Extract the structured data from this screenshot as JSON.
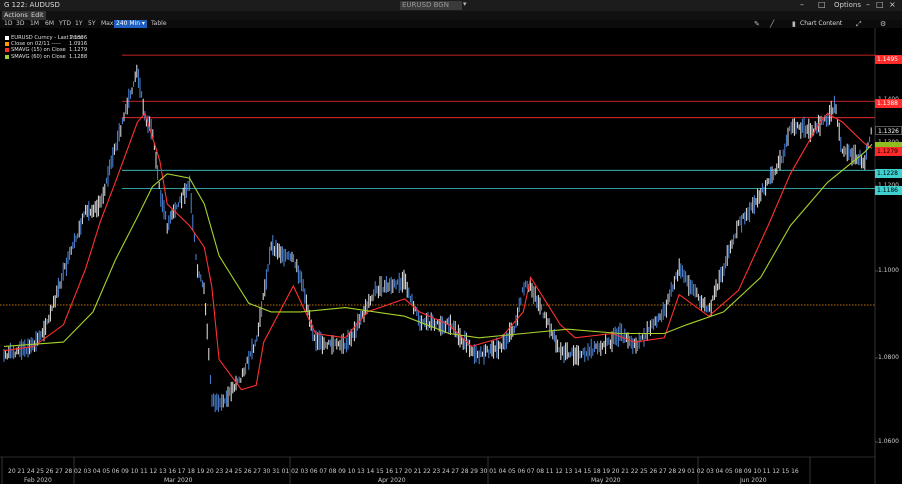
{
  "window": {
    "title": "G 122: AUDUSD",
    "security_field": "EURUSD BGN Curncy",
    "options_label": "Options",
    "controls": [
      "–",
      "□",
      "×"
    ]
  },
  "menu": {
    "actions": "Actions",
    "edit": "Edit"
  },
  "toolbar": {
    "periods": [
      "1D",
      "3D",
      "1M",
      "6M",
      "YTD",
      "1Y",
      "5Y",
      "Max"
    ],
    "interval": "240 Min",
    "table_label": "Table",
    "chart_content_label": "Chart Content"
  },
  "legend": [
    {
      "name": "EURUSD Curncy - Last Price",
      "value": "1.1336",
      "color": "#ffffff"
    },
    {
      "name": "Close on 02/11 -----",
      "value": "1.0916",
      "color": "#ff9900"
    },
    {
      "name": "SMAVG (15) on Close",
      "value": "1.1279",
      "color": "#ff3030"
    },
    {
      "name": "SMAVG (60) on Close",
      "value": "1.1288",
      "color": "#a6d22c"
    }
  ],
  "y_axis": {
    "labels": [
      "1.1400",
      "1.1300",
      "1.1200",
      "1.1000",
      "1.0800",
      "1.0600"
    ]
  },
  "x_axis": {
    "day_labels": [
      "20",
      "21",
      "24",
      "25",
      "26",
      "27",
      "28",
      "02",
      "03",
      "04",
      "05",
      "06",
      "09",
      "10",
      "11",
      "12",
      "13",
      "16",
      "17",
      "18",
      "19",
      "20",
      "23",
      "24",
      "25",
      "26",
      "27",
      "30",
      "31",
      "01",
      "02",
      "03",
      "06",
      "07",
      "08",
      "09",
      "10",
      "13",
      "14",
      "15",
      "16",
      "17",
      "20",
      "21",
      "22",
      "23",
      "24",
      "27",
      "28",
      "29",
      "30",
      "01",
      "04",
      "05",
      "06",
      "07",
      "08",
      "11",
      "12",
      "13",
      "14",
      "15",
      "18",
      "19",
      "20",
      "21",
      "22",
      "25",
      "26",
      "27",
      "28",
      "29",
      "01",
      "02",
      "03",
      "04",
      "05",
      "08",
      "09",
      "10",
      "11",
      "12",
      "15",
      "16"
    ],
    "month_labels": [
      "Feb 2020",
      "Mar 2020",
      "Apr 2020",
      "May 2020",
      "Jun 2020"
    ]
  },
  "chart_data": {
    "type": "line",
    "title": "",
    "xlabel": "",
    "ylabel": "",
    "ylim": [
      1.058,
      1.153
    ],
    "x_range": [
      "2020-02-20",
      "2020-06-16"
    ],
    "grid": false,
    "series": [
      {
        "name": "EURUSD Curncy - Last Price",
        "style": "ohlc-bars",
        "color": "#ffffff",
        "x": [
          "2020-02-20",
          "2020-02-24",
          "2020-02-26",
          "2020-02-28",
          "2020-03-02",
          "2020-03-04",
          "2020-03-06",
          "2020-03-09",
          "2020-03-10",
          "2020-03-11",
          "2020-03-12",
          "2020-03-13",
          "2020-03-16",
          "2020-03-17",
          "2020-03-18",
          "2020-03-19",
          "2020-03-20",
          "2020-03-23",
          "2020-03-25",
          "2020-03-27",
          "2020-03-30",
          "2020-03-31",
          "2020-04-02",
          "2020-04-06",
          "2020-04-08",
          "2020-04-10",
          "2020-04-14",
          "2020-04-16",
          "2020-04-20",
          "2020-04-22",
          "2020-04-24",
          "2020-04-27",
          "2020-04-29",
          "2020-04-30",
          "2020-05-01",
          "2020-05-05",
          "2020-05-07",
          "2020-05-11",
          "2020-05-13",
          "2020-05-15",
          "2020-05-19",
          "2020-05-21",
          "2020-05-25",
          "2020-05-27",
          "2020-05-29",
          "2020-06-02",
          "2020-06-04",
          "2020-06-05",
          "2020-06-08",
          "2020-06-10",
          "2020-06-11",
          "2020-06-12",
          "2020-06-15",
          "2020-06-16"
        ],
        "y": [
          1.08,
          1.082,
          1.088,
          1.099,
          1.113,
          1.115,
          1.128,
          1.146,
          1.135,
          1.132,
          1.118,
          1.11,
          1.12,
          1.1,
          1.095,
          1.07,
          1.068,
          1.075,
          1.083,
          1.105,
          1.102,
          1.098,
          1.083,
          1.082,
          1.088,
          1.095,
          1.097,
          1.088,
          1.087,
          1.083,
          1.08,
          1.082,
          1.087,
          1.096,
          1.096,
          1.081,
          1.08,
          1.082,
          1.085,
          1.082,
          1.09,
          1.1,
          1.09,
          1.1,
          1.11,
          1.12,
          1.126,
          1.133,
          1.132,
          1.135,
          1.138,
          1.127,
          1.125,
          1.132
        ]
      },
      {
        "name": "SMAVG (15) on Close",
        "value": 1.1279,
        "color": "#ff3030",
        "x": [
          "2020-02-20",
          "2020-02-24",
          "2020-02-28",
          "2020-03-02",
          "2020-03-04",
          "2020-03-06",
          "2020-03-09",
          "2020-03-10",
          "2020-03-12",
          "2020-03-13",
          "2020-03-16",
          "2020-03-18",
          "2020-03-19",
          "2020-03-20",
          "2020-03-23",
          "2020-03-25",
          "2020-03-26",
          "2020-03-30",
          "2020-04-02",
          "2020-04-06",
          "2020-04-09",
          "2020-04-14",
          "2020-04-16",
          "2020-04-20",
          "2020-04-23",
          "2020-04-27",
          "2020-04-30",
          "2020-05-01",
          "2020-05-05",
          "2020-05-07",
          "2020-05-12",
          "2020-05-15",
          "2020-05-19",
          "2020-05-21",
          "2020-05-25",
          "2020-05-29",
          "2020-06-02",
          "2020-06-05",
          "2020-06-09",
          "2020-06-10",
          "2020-06-12",
          "2020-06-15",
          "2020-06-16"
        ],
        "y": [
          1.081,
          1.082,
          1.087,
          1.1,
          1.111,
          1.12,
          1.134,
          1.136,
          1.125,
          1.115,
          1.11,
          1.105,
          1.096,
          1.079,
          1.072,
          1.073,
          1.083,
          1.096,
          1.085,
          1.084,
          1.09,
          1.093,
          1.09,
          1.087,
          1.082,
          1.084,
          1.09,
          1.098,
          1.087,
          1.084,
          1.085,
          1.083,
          1.084,
          1.094,
          1.089,
          1.095,
          1.11,
          1.122,
          1.134,
          1.136,
          1.134,
          1.129,
          1.1279
        ]
      },
      {
        "name": "SMAVG (60) on Close",
        "value": 1.1288,
        "color": "#a6d22c",
        "x": [
          "2020-02-20",
          "2020-02-28",
          "2020-03-03",
          "2020-03-06",
          "2020-03-09",
          "2020-03-11",
          "2020-03-13",
          "2020-03-16",
          "2020-03-18",
          "2020-03-20",
          "2020-03-24",
          "2020-03-27",
          "2020-03-31",
          "2020-04-06",
          "2020-04-14",
          "2020-04-20",
          "2020-04-24",
          "2020-04-30",
          "2020-05-06",
          "2020-05-13",
          "2020-05-19",
          "2020-05-22",
          "2020-05-27",
          "2020-06-01",
          "2020-06-05",
          "2020-06-10",
          "2020-06-15",
          "2020-06-16"
        ],
        "y": [
          1.082,
          1.083,
          1.09,
          1.102,
          1.112,
          1.119,
          1.122,
          1.121,
          1.115,
          1.103,
          1.092,
          1.09,
          1.09,
          1.091,
          1.089,
          1.085,
          1.084,
          1.085,
          1.086,
          1.085,
          1.085,
          1.087,
          1.09,
          1.098,
          1.11,
          1.12,
          1.127,
          1.1288
        ]
      },
      {
        "name": "Close on 02/11",
        "value": 1.0916,
        "color": "#ff9900",
        "style": "horizontal-dotted"
      }
    ],
    "horizontal_lines": [
      {
        "value": 1.1495,
        "label": "1.1495",
        "color": "#ff3030"
      },
      {
        "value": 1.1388,
        "label": "1.1388",
        "color": "#ff3030"
      },
      {
        "value": 1.135,
        "label": "",
        "color": "#ff3030"
      },
      {
        "value": 1.1228,
        "label": "1.1228",
        "color": "#3fd0d0"
      },
      {
        "value": 1.1186,
        "label": "1.1186",
        "color": "#3fd0d0"
      }
    ],
    "price_tags": [
      {
        "value": 1.1326,
        "label": "1.1326",
        "bg": "#000000",
        "fg": "#ffffff"
      },
      {
        "value": 1.1288,
        "label": "",
        "bg": "#8fbf1f",
        "fg": "#000000"
      },
      {
        "value": 1.1279,
        "label": "1.1279",
        "bg": "#ff3030",
        "fg": "#000000"
      }
    ]
  }
}
